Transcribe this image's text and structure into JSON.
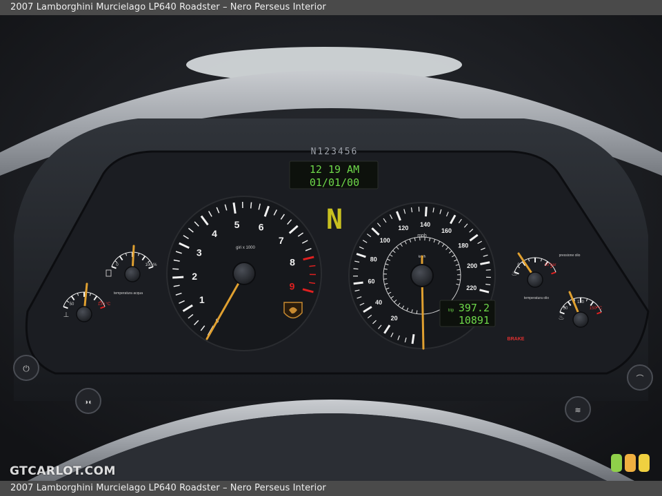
{
  "caption": {
    "title": "2007 Lamborghini Murcielago LP640 Roadster – Nero Perseus Interior"
  },
  "watermark": "GTCARLOT.COM",
  "cluster": {
    "vin": "N123456",
    "clock_time": "12 19 AM",
    "clock_date": "01/01/00",
    "gear": "N",
    "tach_label": "giri x 1000",
    "tach_numbers": [
      "1",
      "2",
      "3",
      "4",
      "5",
      "6",
      "7",
      "8",
      "9"
    ],
    "tach_zero": "0",
    "speedo_unit": "mph",
    "speedo_numbers": [
      "20",
      "40",
      "60",
      "80",
      "100",
      "120",
      "140",
      "160",
      "180",
      "200",
      "220"
    ],
    "speedo_km_unit": "km/h",
    "trip": "397.2",
    "odometer": "10891",
    "trip_label": "trip",
    "brake_label": "BRAKE",
    "fuel_low": "0",
    "fuel_high": "100 %",
    "water_temp_low": "50",
    "water_temp_high": "130 °C",
    "water_temp_label": "temperatura acqua",
    "oil_pressure_low": "0",
    "oil_pressure_high": "10 bar",
    "oil_pressure_label": "pressione olio",
    "oil_temp_low": "50",
    "oil_temp_mid": "130",
    "oil_temp_high": "150 °C",
    "oil_temp_label": "temperatura olio",
    "needle_color": "#e0a030",
    "lcd_color": "#6ed84a",
    "redline_color": "#e02020"
  }
}
